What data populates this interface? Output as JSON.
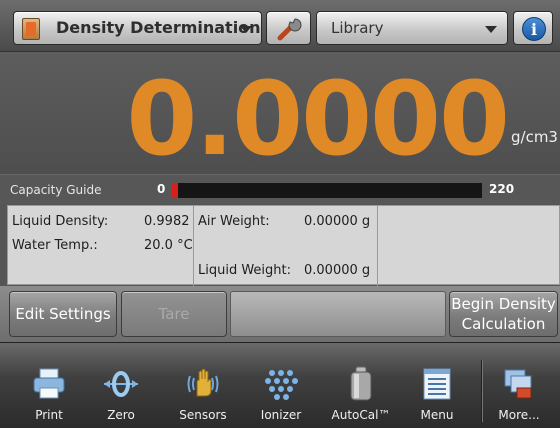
{
  "topbar": {
    "app_label": "Density Determination",
    "library_label": "Library",
    "info_symbol": "i",
    "app_icon": "beaker-icon",
    "settings_icon": "wrench-icon"
  },
  "display": {
    "reading": "0.0000",
    "unit": "g/cm3",
    "reading_color": "#e08a27"
  },
  "capacity": {
    "label": "Capacity Guide",
    "min": "0",
    "max": "220",
    "fill_fraction": 0.02
  },
  "info": {
    "liquid_density_label": "Liquid Density:",
    "liquid_density_value": "0.9982",
    "water_temp_label": "Water Temp.:",
    "water_temp_value": "20.0 °C",
    "air_weight_label": "Air Weight:",
    "air_weight_value": "0.00000 g",
    "liquid_weight_label": "Liquid Weight:",
    "liquid_weight_value": "0.00000 g"
  },
  "buttons": {
    "edit": "Edit Settings",
    "tare": "Tare",
    "begin_line1": "Begin Density",
    "begin_line2": "Calculation"
  },
  "toolbar": {
    "items": [
      {
        "label": "Print",
        "icon": "printer-icon"
      },
      {
        "label": "Zero",
        "icon": "zero-icon"
      },
      {
        "label": "Sensors",
        "icon": "hand-sensor-icon"
      },
      {
        "label": "Ionizer",
        "icon": "ionizer-icon"
      },
      {
        "label": "AutoCal™",
        "icon": "calibration-weight-icon"
      },
      {
        "label": "Menu",
        "icon": "menu-icon"
      },
      {
        "label": "More...",
        "icon": "more-icon"
      }
    ]
  }
}
